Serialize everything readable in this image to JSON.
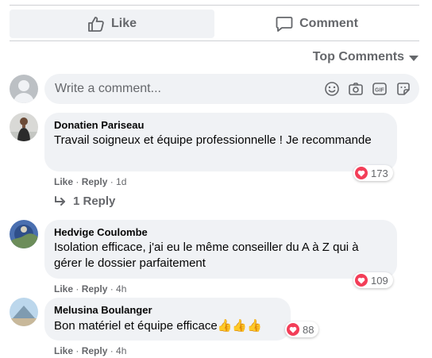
{
  "actions": {
    "like_label": "Like",
    "comment_label": "Comment"
  },
  "sort": {
    "label": "Top Comments"
  },
  "composer": {
    "placeholder": "Write a comment..."
  },
  "colors": {
    "reaction_heart": "#f33e58",
    "bubble_bg": "#f0f2f5",
    "muted_text": "#65676b"
  },
  "comments": [
    {
      "author": "Donatien Pariseau",
      "text": "Travail soigneux et équipe professionnelle ! Je recommande",
      "like": "Like",
      "reply": "Reply",
      "time": "1d",
      "reaction_count": "173",
      "replies_label": "1 Reply"
    },
    {
      "author": "Hedvige Coulombe",
      "text": "Isolation efficace, j'ai eu le même conseiller du A à Z qui à gérer le dossier parfaitement",
      "like": "Like",
      "reply": "Reply",
      "time": "4h",
      "reaction_count": "109"
    },
    {
      "author": "Melusina Boulanger",
      "text": "Bon matériel et équipe efficace",
      "emoji": "👍👍👍",
      "like": "Like",
      "reply": "Reply",
      "time": "4h",
      "reaction_count": "88"
    }
  ]
}
